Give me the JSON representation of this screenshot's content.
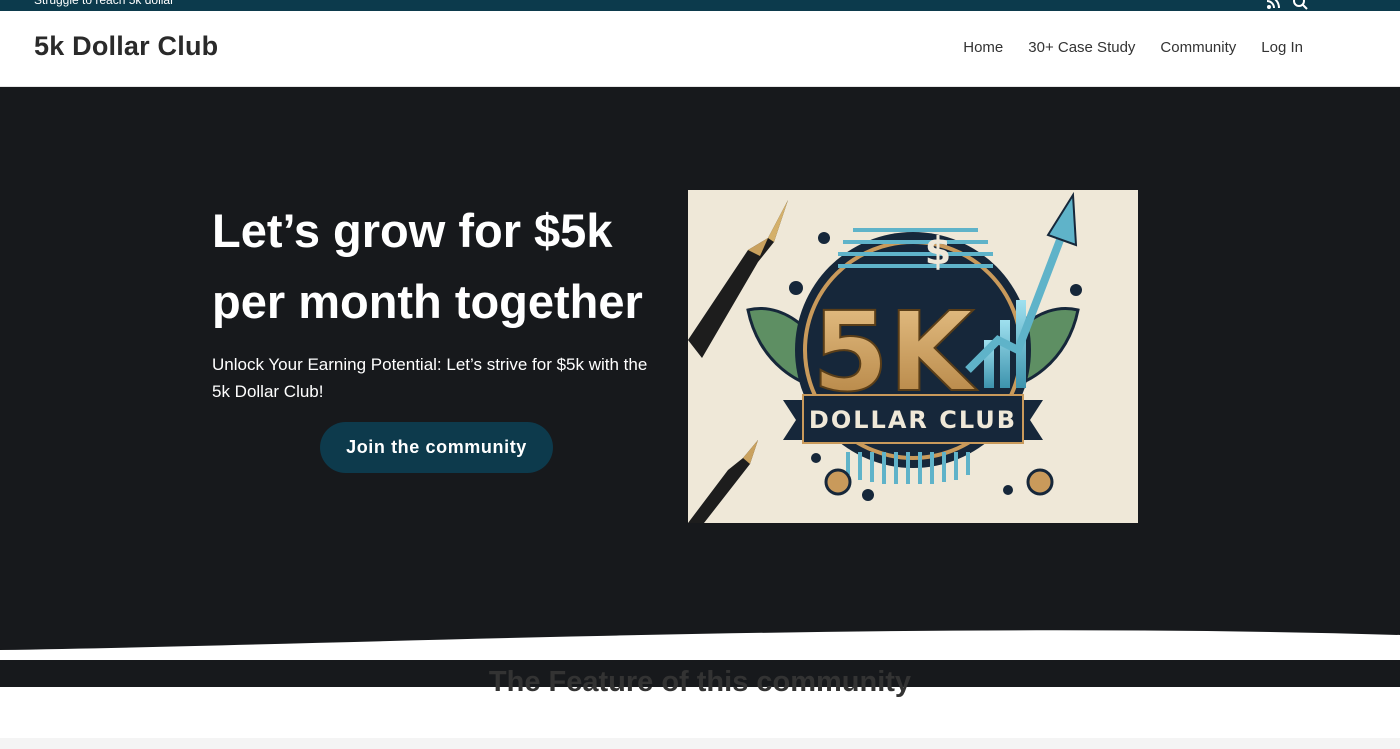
{
  "topbar": {
    "tagline": "Struggle to reach 5k dollar",
    "icons": [
      "rss-icon",
      "search-icon"
    ]
  },
  "header": {
    "site_title": "5k Dollar Club",
    "nav": [
      {
        "label": "Home"
      },
      {
        "label": "30+ Case Study"
      },
      {
        "label": "Community"
      },
      {
        "label": "Log In"
      }
    ]
  },
  "hero": {
    "title": "Let’s grow for $5k per month together",
    "subtitle": "Unlock Your Earning Potential: Let’s strive for $5k with the 5k Dollar Club!",
    "cta_label": "Join the community",
    "logo": {
      "dollar_sign": "$",
      "big_text": "5K",
      "banner_text": "DOLLAR CLUB"
    }
  },
  "features": {
    "title": "The Feature of this community"
  },
  "colors": {
    "topbar": "#0c3a4c",
    "hero_bg": "#17191c",
    "cta_bg": "#0d3a4c",
    "logo_gold": "#c99a5b",
    "logo_teal": "#5fb3c9",
    "logo_navy": "#16273a"
  }
}
